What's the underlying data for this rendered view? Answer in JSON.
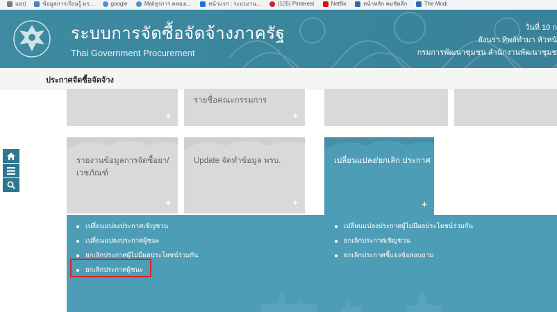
{
  "bookmarks": [
    {
      "label": "แอป",
      "color": "#7b7b7b"
    },
    {
      "label": "ข้อมูลการเรียนรู้ มร...",
      "color": "#4a7fc1"
    },
    {
      "label": "google",
      "color": "#4a90d9"
    },
    {
      "label": "Mailธุรการ คลองเ...",
      "color": "#4a90d9"
    },
    {
      "label": "หน้าแรก : ระบบงาน...",
      "color": "#1a73e8"
    },
    {
      "label": "(105) Pinterest",
      "color": "#c8232c"
    },
    {
      "label": "Netflix",
      "color": "#e50914"
    },
    {
      "label": "หน้าหลัก คมชัดลึก",
      "color": "#3366aa"
    },
    {
      "label": "The Modi",
      "color": "#2b6cb0"
    }
  ],
  "header": {
    "title_th": "ระบบการจัดซื้อจัดจ้างภาครัฐ",
    "title_en": "Thai Government Procurement",
    "date": "วันที่ 10 ก",
    "user": "ยังนรา ทิพย์ทำมา หัวหน้",
    "department": "กรมการพัฒนาชุมชน สำนักงานพัฒนาชุมช"
  },
  "breadcrumb": "ประกาศจัดซื้อจัดจ้าง",
  "tools": [
    {
      "icon": "home-icon",
      "glyph": "⌂"
    },
    {
      "icon": "menu-icon",
      "glyph": "≡"
    },
    {
      "icon": "search-icon",
      "glyph": "⚲"
    }
  ],
  "tiles": {
    "committee": "รายชื่อคณะกรรมการ",
    "report_line1": "รายงานข้อมูลการจัดซื้อยา/",
    "report_line2": "เวชภัณฑ์",
    "update": "Update จัดทำข้อมูล พรบ.",
    "change_cancel": "เปลี่ยนแปลง/ยกเลิก ประกาศ",
    "plus": "+"
  },
  "menu_left": [
    "เปลี่ยนแปลงประกาศเชิญชวน",
    "เปลี่ยนแปลงประกาศผู้ชนะ",
    "ยกเลิกประกาศผู้ไม่มีผลประโยชน์ร่วมกัน",
    "ยกเลิกประกาศผู้ชนะ"
  ],
  "menu_right": [
    "เปลี่ยนแปลงประกาศผู้ไม่มีผลประโยชน์ร่วมกัน",
    "ยกเลิกประกาศเชิญชวน",
    "ยกเลิกประกาศชี้แจงข้อสอบถาม"
  ],
  "colors": {
    "header": "#3d889f",
    "tile": "#d9d9d9",
    "active": "#4e9db6",
    "highlight": "#e02020"
  }
}
